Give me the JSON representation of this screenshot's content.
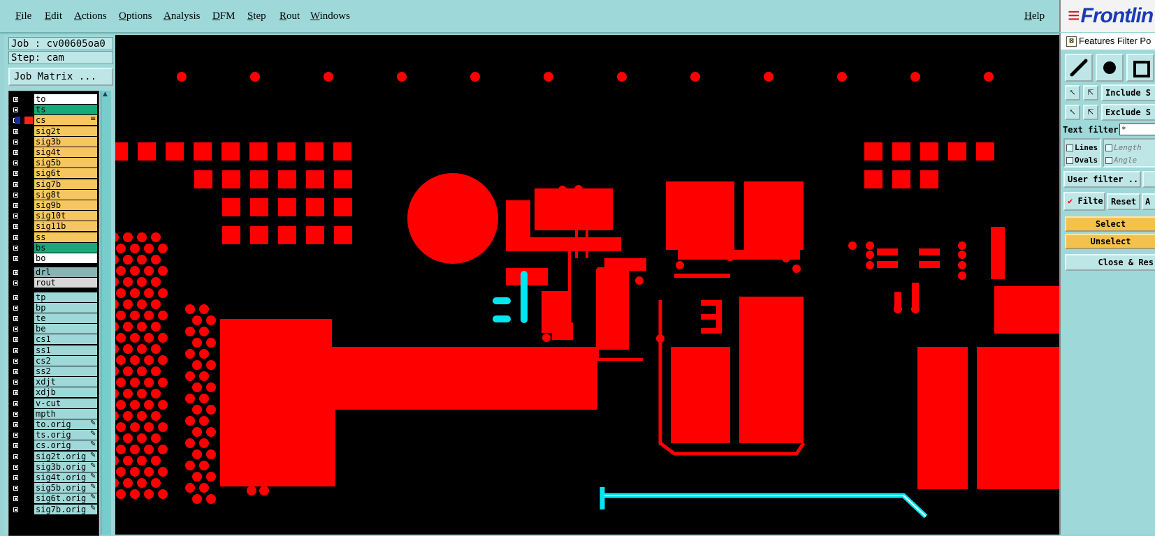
{
  "menu": {
    "items": [
      "File",
      "Edit",
      "Actions",
      "Options",
      "Analysis",
      "DFM",
      "Step",
      "Rout",
      "Windows"
    ],
    "help": "Help",
    "logo": "Frontlin"
  },
  "job": {
    "job_label": "Job : cv00605oa0",
    "step_label": "Step: cam",
    "matrix_button": "Job Matrix ..."
  },
  "layers": [
    {
      "name": "to",
      "bg": "#ffffff"
    },
    {
      "name": "ts",
      "bg": "#1aa77a"
    },
    {
      "name": "cs",
      "bg": "#f6c760",
      "active": true
    },
    {
      "name": "sig2t",
      "bg": "#f6c760"
    },
    {
      "name": "sig3b",
      "bg": "#f6c760"
    },
    {
      "name": "sig4t",
      "bg": "#f6c760"
    },
    {
      "name": "sig5b",
      "bg": "#f6c760"
    },
    {
      "name": "sig6t",
      "bg": "#f6c760"
    },
    {
      "name": "sig7b",
      "bg": "#f6c760"
    },
    {
      "name": "sig8t",
      "bg": "#f6c760"
    },
    {
      "name": "sig9b",
      "bg": "#f6c760"
    },
    {
      "name": "sig10t",
      "bg": "#f6c760"
    },
    {
      "name": "sig11b",
      "bg": "#f6c760"
    },
    {
      "name": "ss",
      "bg": "#f6c760"
    },
    {
      "name": "bs",
      "bg": "#1aa77a"
    },
    {
      "name": "bo",
      "bg": "#ffffff"
    },
    {
      "name": "drl",
      "bg": "#8ab3b3",
      "gap": true
    },
    {
      "name": "rout",
      "bg": "#d8d8d8"
    },
    {
      "name": "tp",
      "bg": "#9fd8d8",
      "gap": true
    },
    {
      "name": "bp",
      "bg": "#9fd8d8"
    },
    {
      "name": "te",
      "bg": "#9fd8d8"
    },
    {
      "name": "be",
      "bg": "#9fd8d8"
    },
    {
      "name": "cs1",
      "bg": "#9fd8d8"
    },
    {
      "name": "ss1",
      "bg": "#9fd8d8"
    },
    {
      "name": "cs2",
      "bg": "#9fd8d8"
    },
    {
      "name": "ss2",
      "bg": "#9fd8d8"
    },
    {
      "name": "xdjt",
      "bg": "#9fd8d8"
    },
    {
      "name": "xdjb",
      "bg": "#9fd8d8"
    },
    {
      "name": "v-cut",
      "bg": "#9fd8d8"
    },
    {
      "name": "mpth",
      "bg": "#9fd8d8"
    },
    {
      "name": "to.orig",
      "bg": "#9fd8d8",
      "link": true
    },
    {
      "name": "ts.orig",
      "bg": "#9fd8d8",
      "link": true
    },
    {
      "name": "cs.orig",
      "bg": "#9fd8d8",
      "link": true
    },
    {
      "name": "sig2t.orig",
      "bg": "#9fd8d8",
      "link": true
    },
    {
      "name": "sig3b.orig",
      "bg": "#9fd8d8",
      "link": true
    },
    {
      "name": "sig4t.orig",
      "bg": "#9fd8d8",
      "link": true
    },
    {
      "name": "sig5b.orig",
      "bg": "#9fd8d8",
      "link": true
    },
    {
      "name": "sig6t.orig",
      "bg": "#9fd8d8",
      "link": true
    },
    {
      "name": "sig7b.orig",
      "bg": "#9fd8d8",
      "link": true
    }
  ],
  "popup": {
    "title": "Features Filter Po",
    "include": "Include S",
    "exclude": "Exclude S",
    "text_filter_label": "Text filter",
    "text_filter_value": "*",
    "lines": "Lines",
    "ovals": "Ovals",
    "length": "Length",
    "angle": "Angle",
    "user_filter": "User filter ...",
    "filter": "Filter",
    "reset": "Reset",
    "a": "A",
    "select": "Select",
    "unselect": "Unselect",
    "close": "Close & Res"
  },
  "colors": {
    "copper": "#ff0000",
    "highlight": "#00e5ef",
    "canvas_bg": "#000000",
    "panel_bg": "#9fd8d8"
  }
}
